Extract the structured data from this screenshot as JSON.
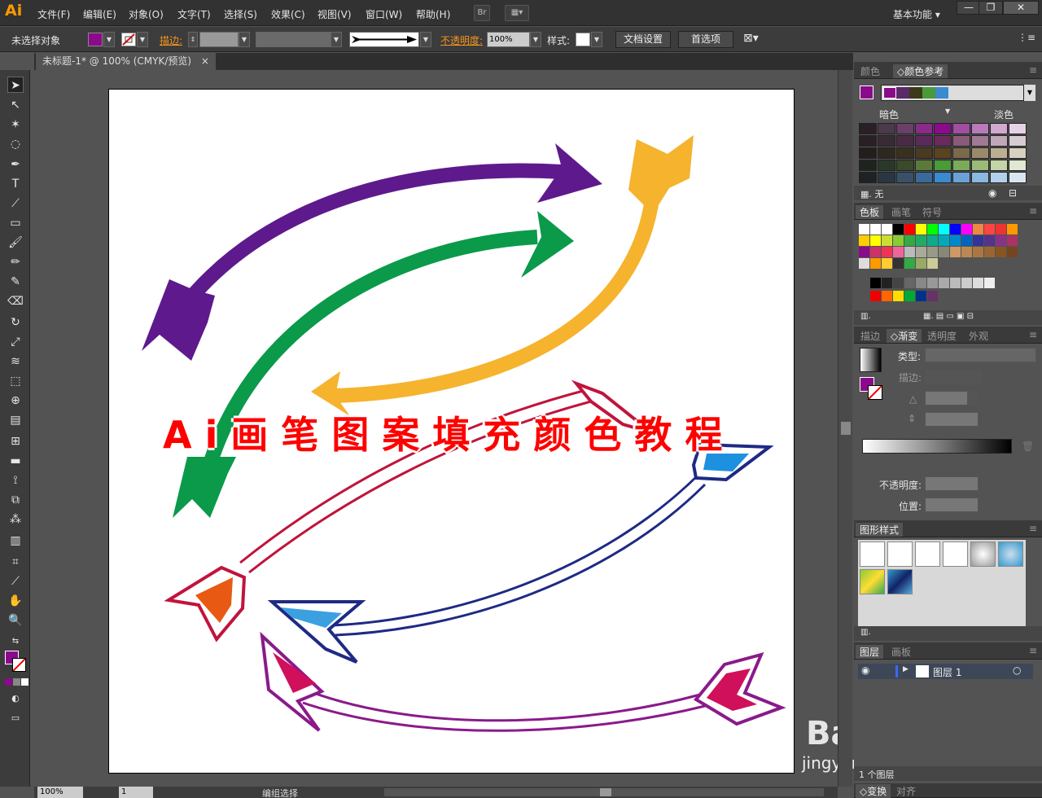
{
  "app": {
    "logo": "Ai",
    "workspace": "基本功能"
  },
  "menu": [
    "文件(F)",
    "编辑(E)",
    "对象(O)",
    "文字(T)",
    "选择(S)",
    "效果(C)",
    "视图(V)",
    "窗口(W)",
    "帮助(H)"
  ],
  "menubar_buttons": {
    "bridge": "Br"
  },
  "control": {
    "selection": "未选择对象",
    "fill_color": "#8b0a8b",
    "stroke_label": "描边:",
    "opacity_label": "不透明度:",
    "opacity_value": "100%",
    "style_label": "样式:",
    "doc_setup": "文档设置",
    "prefs": "首选项"
  },
  "document": {
    "tab_title": "未标题-1* @ 100% (CMYK/预览)",
    "close": "×"
  },
  "artwork": {
    "title": "Ai画笔图案填充颜色教程"
  },
  "watermark": {
    "brand": "Bai经验",
    "url": "jingyan.baidu.com"
  },
  "status": {
    "zoom": "100%",
    "artboard": "1",
    "tool": "编组选择"
  },
  "panels": {
    "color": {
      "tabs": [
        "颜色",
        "颜色参考"
      ],
      "dark": "暗色",
      "light": "淡色",
      "none": "无",
      "harmony": [
        "#8b0a8b",
        "#5a2a6a",
        "#3a3a1a",
        "#4a9a3a",
        "#3a8ad0"
      ]
    },
    "swatches": {
      "tabs": [
        "色板",
        "画笔",
        "符号"
      ]
    },
    "gradient": {
      "tabs": [
        "描边",
        "渐变",
        "透明度",
        "外观"
      ],
      "type_label": "类型:",
      "stroke_label": "描边:",
      "opacity_label": "不透明度:",
      "position_label": "位置:"
    },
    "graphic_styles": {
      "tabs": [
        "图形样式"
      ]
    },
    "layers": {
      "tabs": [
        "图层",
        "画板"
      ],
      "layer_name": "图层 1",
      "count": "1 个图层"
    },
    "bottom": {
      "tabs": [
        "变换",
        "对齐"
      ]
    }
  }
}
